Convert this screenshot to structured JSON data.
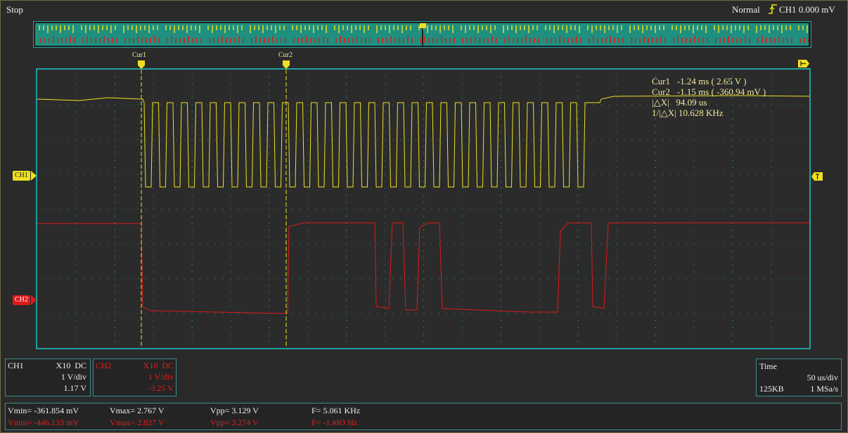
{
  "status": {
    "run_state": "Stop",
    "trigger_mode": "Normal",
    "trigger_source": "CH1 0.000 mV"
  },
  "cursors": {
    "cur1_label": "Cur1",
    "cur2_label": "Cur2",
    "readout": [
      "Cur1   -1.24 ms ( 2.65 V )",
      "Cur2   -1.15 ms ( -360.94 mV )",
      "|△X|   94.09 us",
      "1/|△X| 10.628 KHz"
    ]
  },
  "channels": {
    "ch1": {
      "tag": "CH1",
      "name": "CH1",
      "probe": "X10  DC",
      "scale": "1 V/div",
      "offset": "1.17 V",
      "color": "#f0e020"
    },
    "ch2": {
      "tag": "CH2",
      "name": "CH2",
      "probe": "X10  DC",
      "scale": "1 V/div",
      "offset": "-3.25 V",
      "color": "#e01818"
    }
  },
  "timebase": {
    "title": "Time",
    "scale": "50 us/div",
    "memory": "125KB",
    "rate": "1 MSa/s"
  },
  "measurements": {
    "ch1": {
      "vmin": "Vmin= -361.854 mV",
      "vmax": "Vmax= 2.767 V",
      "vpp": "Vpp= 3.129 V",
      "freq": "F= 5.061 KHz"
    },
    "ch2": {
      "vmin": "Vmin= -446.133 mV",
      "vmax": "Vmax= 2.827 V",
      "vpp": "Vpp= 3.274 V",
      "freq": "F= -1.#IO Hz"
    }
  },
  "colors": {
    "grid": "#1f9e9e",
    "overview_bg": "#1f8f80",
    "cursor": "#f0e020"
  }
}
